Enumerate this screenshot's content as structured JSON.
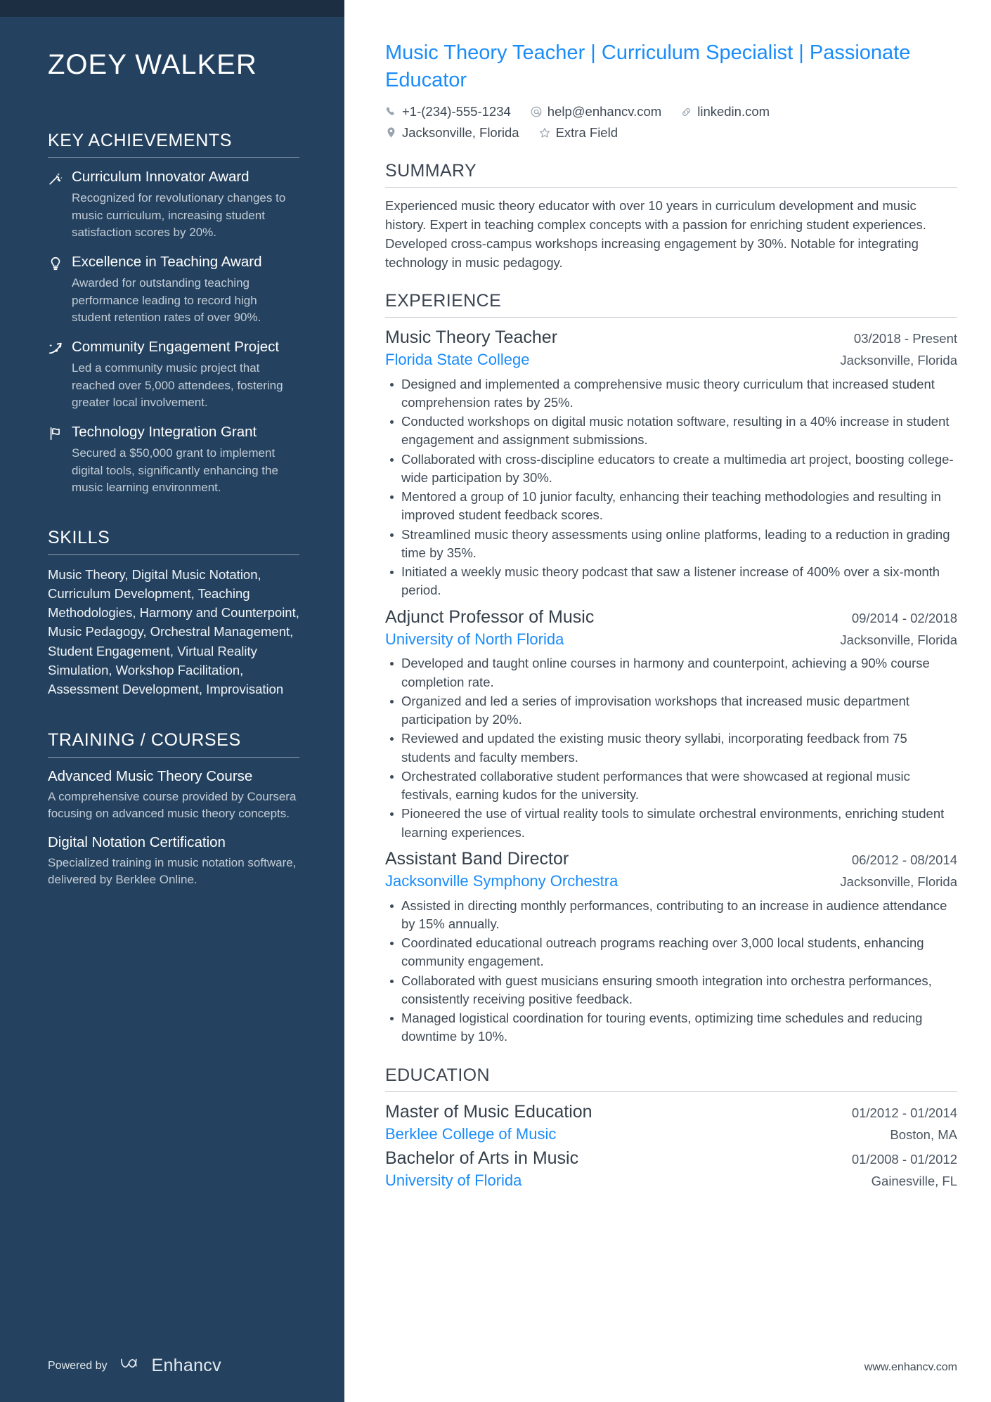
{
  "sidebar": {
    "name": "ZOEY WALKER",
    "achievements": {
      "title": "KEY ACHIEVEMENTS",
      "items": [
        {
          "icon": "magic-wand-icon",
          "title": "Curriculum Innovator Award",
          "description": "Recognized for revolutionary changes to music curriculum, increasing student satisfaction scores by 20%."
        },
        {
          "icon": "lightbulb-icon",
          "title": "Excellence in Teaching Award",
          "description": "Awarded for outstanding teaching performance leading to record high student retention rates of over 90%."
        },
        {
          "icon": "rocket-arrow-icon",
          "title": "Community Engagement Project",
          "description": "Led a community music project that reached over 5,000 attendees, fostering greater local involvement."
        },
        {
          "icon": "flag-icon",
          "title": "Technology Integration Grant",
          "description": "Secured a $50,000 grant to implement digital tools, significantly enhancing the music learning environment."
        }
      ]
    },
    "skills": {
      "title": "SKILLS",
      "text": "Music Theory, Digital Music Notation, Curriculum Development, Teaching Methodologies, Harmony and Counterpoint, Music Pedagogy, Orchestral Management, Student Engagement, Virtual Reality Simulation, Workshop Facilitation, Assessment Development, Improvisation"
    },
    "training": {
      "title": "TRAINING / COURSES",
      "items": [
        {
          "title": "Advanced Music Theory Course",
          "description": "A comprehensive course provided by Coursera focusing on advanced music theory concepts."
        },
        {
          "title": "Digital Notation Certification",
          "description": "Specialized training in music notation software, delivered by Berklee Online."
        }
      ]
    },
    "footer": {
      "powered_by": "Powered by",
      "brand": "Enhancv"
    }
  },
  "main": {
    "headline": "Music Theory Teacher | Curriculum Specialist | Passionate Educator",
    "contact_row_1": [
      {
        "icon": "phone-icon",
        "text": "+1-(234)-555-1234"
      },
      {
        "icon": "at-email-icon",
        "text": "help@enhancv.com"
      },
      {
        "icon": "link-icon",
        "text": "linkedin.com"
      }
    ],
    "contact_row_2": [
      {
        "icon": "location-pin-icon",
        "text": "Jacksonville, Florida"
      },
      {
        "icon": "star-icon",
        "text": "Extra Field"
      }
    ],
    "summary": {
      "title": "SUMMARY",
      "text": "Experienced music theory educator with over 10 years in curriculum development and music history. Expert in teaching complex concepts with a passion for enriching student experiences. Developed cross-campus workshops increasing engagement by 30%. Notable for integrating technology in music pedagogy."
    },
    "experience": {
      "title": "EXPERIENCE",
      "entries": [
        {
          "title": "Music Theory Teacher",
          "date": "03/2018 - Present",
          "organization": "Florida State College",
          "location": "Jacksonville, Florida",
          "bullets": [
            "Designed and implemented a comprehensive music theory curriculum that increased student comprehension rates by 25%.",
            "Conducted workshops on digital music notation software, resulting in a 40% increase in student engagement and assignment submissions.",
            "Collaborated with cross-discipline educators to create a multimedia art project, boosting college-wide participation by 30%.",
            "Mentored a group of 10 junior faculty, enhancing their teaching methodologies and resulting in improved student feedback scores.",
            "Streamlined music theory assessments using online platforms, leading to a reduction in grading time by 35%.",
            "Initiated a weekly music theory podcast that saw a listener increase of 400% over a six-month period."
          ]
        },
        {
          "title": "Adjunct Professor of Music",
          "date": "09/2014 - 02/2018",
          "organization": "University of North Florida",
          "location": "Jacksonville, Florida",
          "bullets": [
            "Developed and taught online courses in harmony and counterpoint, achieving a 90% course completion rate.",
            "Organized and led a series of improvisation workshops that increased music department participation by 20%.",
            "Reviewed and updated the existing music theory syllabi, incorporating feedback from 75 students and faculty members.",
            "Orchestrated collaborative student performances that were showcased at regional music festivals, earning kudos for the university.",
            "Pioneered the use of virtual reality tools to simulate orchestral environments, enriching student learning experiences."
          ]
        },
        {
          "title": "Assistant Band Director",
          "date": "06/2012 - 08/2014",
          "organization": "Jacksonville Symphony Orchestra",
          "location": "Jacksonville, Florida",
          "bullets": [
            "Assisted in directing monthly performances, contributing to an increase in audience attendance by 15% annually.",
            "Coordinated educational outreach programs reaching over 3,000 local students, enhancing community engagement.",
            "Collaborated with guest musicians ensuring smooth integration into orchestra performances, consistently receiving positive feedback.",
            "Managed logistical coordination for touring events, optimizing time schedules and reducing downtime by 10%."
          ]
        }
      ]
    },
    "education": {
      "title": "EDUCATION",
      "entries": [
        {
          "title": "Master of Music Education",
          "date": "01/2012 - 01/2014",
          "organization": "Berklee College of Music",
          "location": "Boston, MA"
        },
        {
          "title": "Bachelor of Arts in Music",
          "date": "01/2008 - 01/2012",
          "organization": "University of Florida",
          "location": "Gainesville, FL"
        }
      ]
    },
    "footer": {
      "site": "www.enhancv.com"
    }
  },
  "colors": {
    "sidebar_bg": "#24425f",
    "sidebar_topbar": "#1b2e42",
    "accent_blue": "#1a8cfa",
    "body_text": "#3f4a55",
    "heading_text": "#3b4551"
  }
}
